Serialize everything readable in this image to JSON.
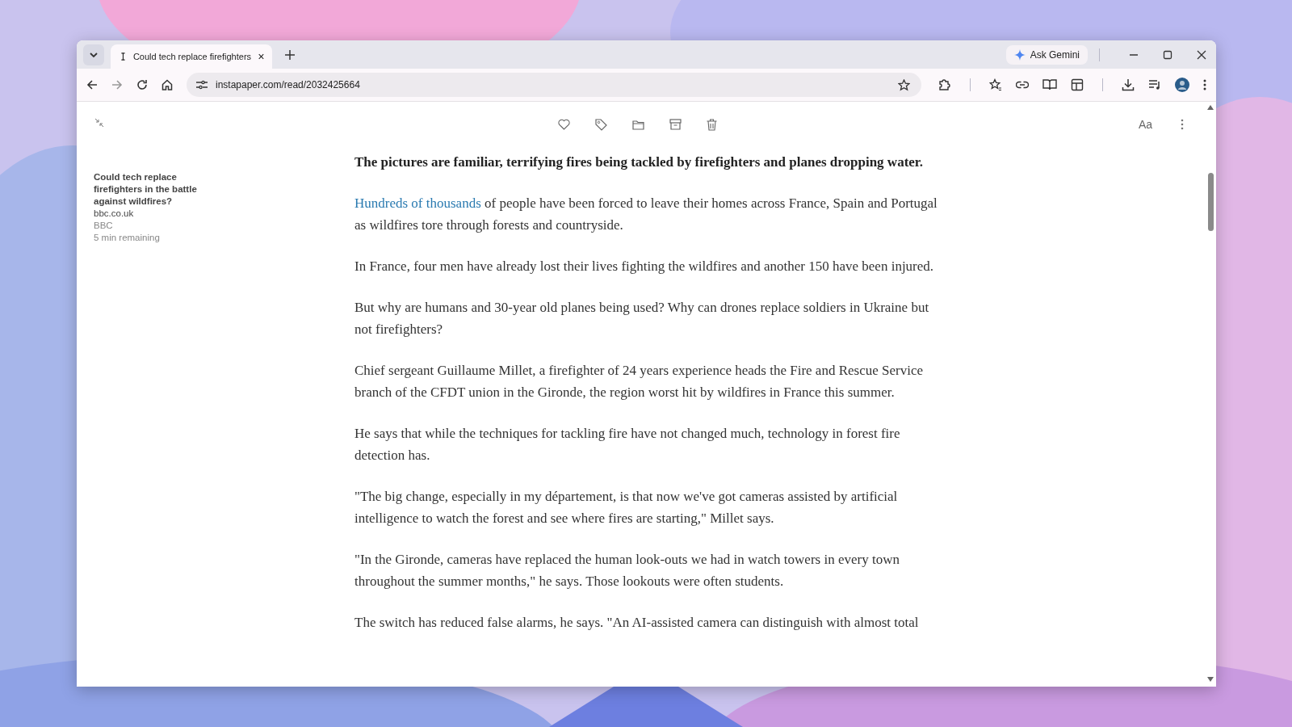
{
  "browser": {
    "tab": {
      "title": "Could tech replace firefighters",
      "selected": true
    },
    "ask_button": "Ask Gemini",
    "url": "instapaper.com/read/2032425664"
  },
  "sidebar": {
    "title": "Could tech replace firefighters in the battle against wildfires?",
    "domain": "bbc.co.uk",
    "author": "BBC",
    "time_left": "5 min remaining"
  },
  "reader_toolbar": {
    "font_button": "Aa"
  },
  "article": {
    "paragraphs": [
      {
        "kind": "lead",
        "text": "The pictures are familiar, terrifying fires being tackled by firefighters and planes dropping water."
      },
      {
        "kind": "body",
        "link": "Hundreds of thousands",
        "text": " of people have been forced to leave their homes across France, Spain and Portugal as wildfires tore through forests and countryside."
      },
      {
        "kind": "body",
        "text": "In France, four men have already lost their lives fighting the wildfires and another 150 have been injured."
      },
      {
        "kind": "body",
        "text": "But why are humans and 30-year old planes being used? Why can drones replace soldiers in Ukraine but not firefighters?"
      },
      {
        "kind": "body",
        "text": "Chief sergeant Guillaume Millet, a firefighter of 24 years experience heads the Fire and Rescue Service branch of the CFDT union in the Gironde, the region worst hit by wildfires in France this summer."
      },
      {
        "kind": "body",
        "text": "He says that while the techniques for tackling fire have not changed much, technology in forest fire detection has."
      },
      {
        "kind": "body",
        "text": "\"The big change, especially in my département, is that now we've got cameras assisted by artificial intelligence to watch the forest and see where fires are starting,\" Millet says."
      },
      {
        "kind": "body",
        "text": "\"In the Gironde, cameras have replaced the human look-outs we had in watch towers in every town throughout the summer months,\" he says. Those lookouts were often students."
      },
      {
        "kind": "body",
        "text": "The switch has reduced false alarms, he says. \"An AI-assisted camera can distinguish with almost total"
      }
    ]
  }
}
